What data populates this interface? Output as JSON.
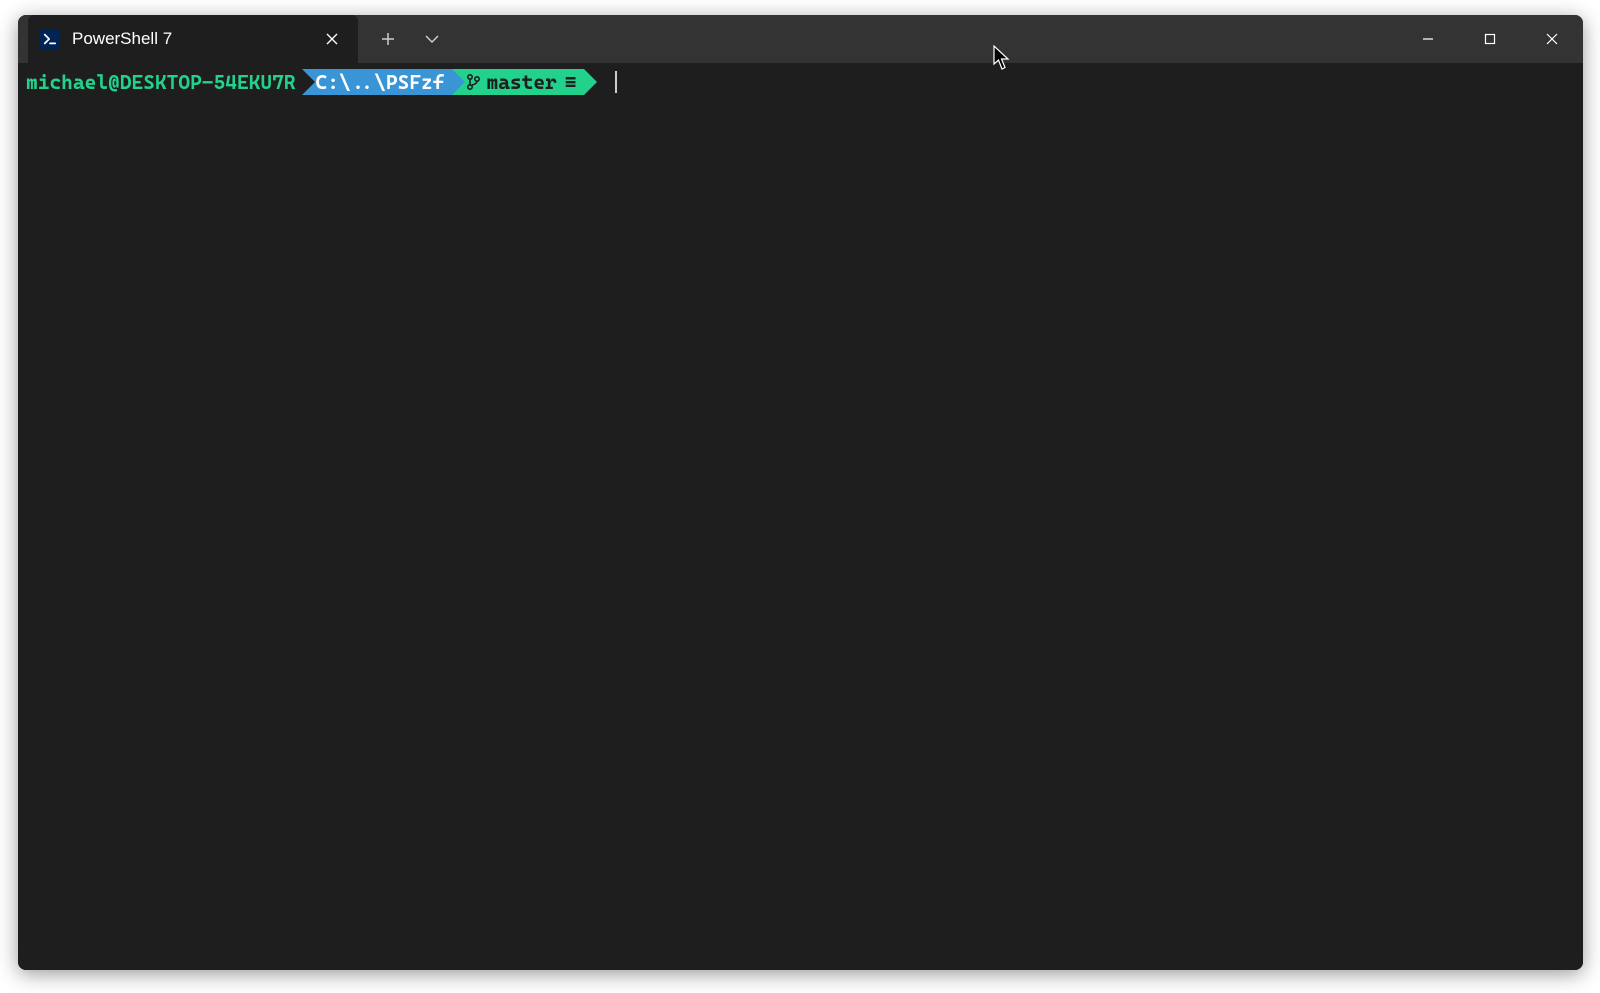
{
  "tab": {
    "title": "PowerShell 7",
    "icon_name": "powershell-icon"
  },
  "prompt": {
    "user_host": "michael@DESKTOP-54EKU7R",
    "path": "C:\\..\\PSFzf",
    "git_branch": "master",
    "git_status_glyph": "≡"
  },
  "colors": {
    "bg": "#1e1e1e",
    "titlebar": "#333333",
    "path_segment": "#3a95d6",
    "git_segment": "#22d18c",
    "user_text": "#22d18c"
  }
}
